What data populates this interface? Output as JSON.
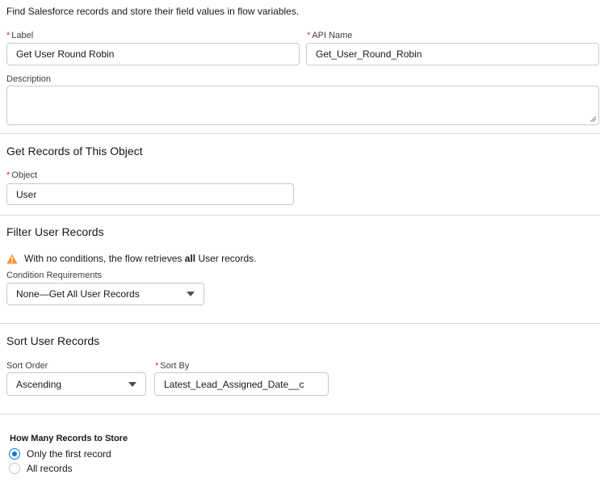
{
  "intro": "Find Salesforce records and store their field values in flow variables.",
  "required_marker": "*",
  "fields": {
    "label": {
      "label": "Label",
      "value": "Get User Round Robin"
    },
    "api_name": {
      "label": "API Name",
      "value": "Get_User_Round_Robin"
    },
    "description": {
      "label": "Description",
      "value": ""
    }
  },
  "object_section": {
    "title": "Get Records of This Object",
    "object_label": "Object",
    "object_value": "User"
  },
  "filter_section": {
    "title": "Filter User Records",
    "warning_prefix": "With no conditions, the flow retrieves ",
    "warning_bold": "all",
    "warning_suffix": " User records.",
    "condition_label": "Condition Requirements",
    "condition_value": "None—Get All User Records"
  },
  "sort_section": {
    "title": "Sort User Records",
    "sort_order_label": "Sort Order",
    "sort_order_value": "Ascending",
    "sort_by_label": "Sort By",
    "sort_by_value": "Latest_Lead_Assigned_Date__c"
  },
  "store_section": {
    "title": "How Many Records to Store",
    "options": [
      {
        "label": "Only the first record",
        "checked": true
      },
      {
        "label": "All records",
        "checked": false
      }
    ]
  },
  "colors": {
    "required": "#c23934",
    "brand": "#0176d3",
    "warning": "#fe9339",
    "border": "#c9c9c9"
  },
  "icons": {
    "warning": "warning-icon",
    "dropdown": "chevron-down-icon",
    "resize": "resize-grip-icon"
  }
}
